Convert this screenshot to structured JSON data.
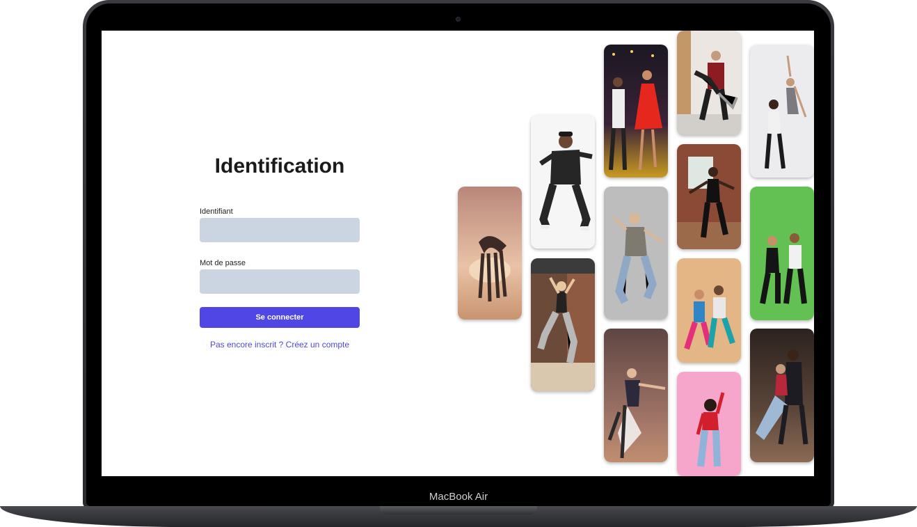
{
  "device": {
    "brand_label": "MacBook Air"
  },
  "login": {
    "title": "Identification",
    "username": {
      "label": "Identifiant",
      "value": "",
      "placeholder": ""
    },
    "password": {
      "label": "Mot de passe",
      "value": "",
      "placeholder": ""
    },
    "submit_label": "Se connecter",
    "register_link": "Pas encore inscrit ? Créez un compte"
  },
  "colors": {
    "accent": "#4f46e5",
    "input_bg": "#cbd5e1"
  },
  "gallery": {
    "photos": [
      {
        "subject": "duo-dance-sunset-photo",
        "bg": "#d8a58a"
      },
      {
        "subject": "hiphop-dancer-photo",
        "bg": "#f4f4f4"
      },
      {
        "subject": "jumping-dancer-loft-photo",
        "bg": "#5a4034"
      },
      {
        "subject": "salsa-couple-stage-photo",
        "bg": "#2b1d2a"
      },
      {
        "subject": "jumping-dancer-gray-photo",
        "bg": "#bdbdbd"
      },
      {
        "subject": "ballet-duo-photo",
        "bg": "#7b5650"
      },
      {
        "subject": "couple-dance-loft-photo",
        "bg": "#e9e4df"
      },
      {
        "subject": "dancer-brick-room-photo",
        "bg": "#8a4a36"
      },
      {
        "subject": "retro-duo-dancers-photo",
        "bg": "#e2b484"
      },
      {
        "subject": "dancer-pink-background-photo",
        "bg": "#f3a6c9"
      },
      {
        "subject": "lift-duo-white-photo",
        "bg": "#ecebed"
      },
      {
        "subject": "duo-green-screen-photo",
        "bg": "#63c052"
      },
      {
        "subject": "tango-couple-photo",
        "bg": "#4a3a33"
      }
    ]
  }
}
